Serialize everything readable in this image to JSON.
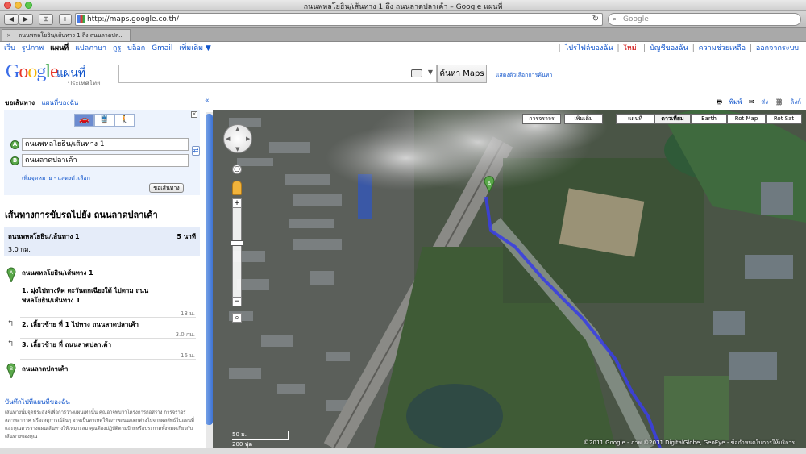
{
  "window": {
    "title": "ถนนพหลโยธิน/เส้นทาง 1 ถึง ถนนลาดปลาเค้า – Google แผนที่"
  },
  "toolbar": {
    "url": "http://maps.google.co.th/",
    "search_placeholder": "Google",
    "back": "◀",
    "forward": "▶",
    "grid": "⊞",
    "add": "+"
  },
  "tab": {
    "label": "ถนนพหลโยธิน/เส้นทาง 1 ถึง ถนนลาดปล..."
  },
  "gbar": {
    "left": [
      "เว็บ",
      "รูปภาพ",
      "แผนที่",
      "แปลภาษา",
      "กูรู",
      "บล็อก",
      "Gmail",
      "เพิ่มเติม ▼"
    ],
    "current": "แผนที่",
    "right": [
      "โปรไฟล์ของฉัน",
      "ใหม่!",
      "บัญชีของฉัน",
      "ความช่วยเหลือ",
      "ออกจากระบบ"
    ]
  },
  "header": {
    "logo": "Google",
    "product": "แผนที่",
    "country": "ประเทศไทย",
    "search_button": "ค้นหา Maps",
    "search_options": "แสดงตัวเลือกการค้นหา",
    "query": ""
  },
  "panel": {
    "tabs": [
      "ขอเส้นทาง",
      "แผนที่ของฉัน"
    ],
    "collapse": "«",
    "from": "ถนนพหลโยธิน/เส้นทาง 1",
    "to": "ถนนลาดปลาเค้า",
    "marker_a": "A",
    "marker_b": "B",
    "add_dest": "เพิ่มจุดหมาย - แสดงตัวเลือก",
    "get_directions": "ขอเส้นทาง",
    "route_title": "เส้นทางการขับรถไปยัง ถนนลาดปลาเค้า",
    "summary_road": "ถนนพหลโยธิน/เส้นทาง 1",
    "summary_time": "5 นาที",
    "summary_dist": "3.0 กม.",
    "start": "ถนนพหลโยธิน/เส้นทาง 1",
    "steps": [
      {
        "text": "1. มุ่งไปทางทิศ ตะวันตกเฉียงใต้ ไปตาม ถนน พหลโยธิน/เส้นทาง 1",
        "dist": "13 ม."
      },
      {
        "text": "2. เลี้ยวซ้าย ที่ 1 ไปทาง ถนนลาดปลาเค้า",
        "dist": "3.0 กม."
      },
      {
        "text": "3. เลี้ยวซ้าย ที่ ถนนลาดปลาเค้า",
        "dist": "16 ม."
      }
    ],
    "end": "ถนนลาดปลาเค้า",
    "save": "บันทึกไปที่แผนที่ของฉัน",
    "disclaimer": "เส้นทางนี้มีจุดประสงค์เพื่อการวางแผนเท่านั้น คุณอาจพบว่าโครงการก่อสร้าง การจราจร สภาพอากาศ หรือเหตุการณ์อื่นๆ อาจเป็นสาเหตุให้สภาพถนนแตกต่างไปจากผลลัพธ์ในแผนที่ และคุณควรวางแผนเส้นทางให้เหมาะสม คุณต้องปฏิบัติตามป้ายหรือประกาศทั้งหมดเกี่ยวกับเส้นทางของคุณ"
  },
  "maptools": {
    "print": "พิมพ์",
    "send": "ส่ง",
    "link": "ลิงก์"
  },
  "map": {
    "buttons": [
      "การจราจร",
      "เพิ่มเติม",
      "แผนที่",
      "ดาวเทียม",
      "Earth",
      "Rot Map",
      "Rot Sat"
    ],
    "selected": "ดาวเทียม",
    "scale_m": "50 ม.",
    "scale_ft": "200 ฟุต",
    "copyright": "©2011 Google - ภาพ ©2011 DigitalGlobe, GeoEye - ข้อกำหนดในการให้บริการ",
    "marker": "A",
    "route_color": "#3b3fe0",
    "zoom_in": "+",
    "zoom_out": "−"
  }
}
